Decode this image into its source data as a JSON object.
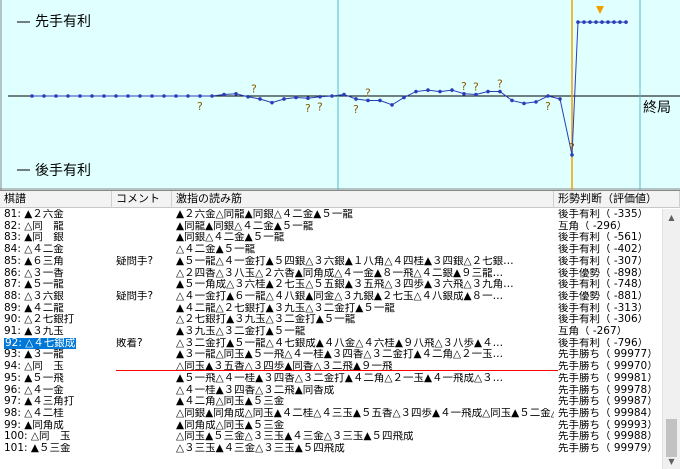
{
  "graph": {
    "label_top": "先手有利",
    "label_bottom": "後手有利",
    "label_end": "終局",
    "question_mark": "?"
  },
  "chart_data": {
    "type": "line",
    "y_axis": "評価値",
    "ylim": [
      -1000,
      1000
    ],
    "current_move": 92,
    "marker_color": "#2a3eb8",
    "background_color": "#e0ffff",
    "cursor_color": "#f0a000",
    "x": [
      2,
      4,
      6,
      8,
      10,
      12,
      14,
      16,
      18,
      20,
      22,
      24,
      26,
      28,
      30,
      32,
      34,
      36,
      38,
      40,
      42,
      44,
      46,
      48,
      50,
      52,
      54,
      56,
      58,
      60,
      62,
      64,
      66,
      68,
      70,
      72,
      74,
      76,
      78,
      80,
      82,
      84,
      86,
      88,
      90,
      92,
      93,
      94,
      95,
      96,
      97,
      98,
      99,
      100,
      101
    ],
    "values": [
      0,
      0,
      0,
      0,
      0,
      0,
      0,
      0,
      0,
      0,
      0,
      0,
      0,
      0,
      0,
      0,
      20,
      30,
      -10,
      -40,
      -90,
      -40,
      -20,
      -30,
      -10,
      0,
      20,
      -40,
      -60,
      -60,
      -120,
      -20,
      60,
      80,
      60,
      80,
      30,
      20,
      60,
      60,
      -60,
      -100,
      -80,
      0,
      -40,
      -796,
      999,
      999,
      999,
      999,
      999,
      999,
      999,
      999,
      999
    ],
    "questions_above_x": [
      39,
      58,
      74,
      76,
      80,
      92
    ],
    "questions_below_x": [
      30,
      48,
      50,
      56,
      88
    ]
  },
  "columns": {
    "move": "棋譜",
    "comment": "コメント",
    "line": "激指の読み筋",
    "eval": "形勢判断（評価値）"
  },
  "rows": [
    {
      "move": "81: ▲２六金",
      "comment": "",
      "line": "▲２六金△同龍▲同銀△４二金▲５一龍",
      "eval": "後手有利（ -335）"
    },
    {
      "move": "82: △同　龍",
      "comment": "",
      "line": "▲同龍▲同銀△４二金▲５一龍",
      "eval": "互角（ -296）"
    },
    {
      "move": "83: ▲同　銀",
      "comment": "",
      "line": "▲同銀△４二金▲５一龍",
      "eval": "後手有利（ -561）"
    },
    {
      "move": "84: △４二金",
      "comment": "",
      "line": "△４二金▲５一龍",
      "eval": "後手有利（ -402）"
    },
    {
      "move": "85: ▲６三角",
      "comment": "疑問手?",
      "line": "▲５一龍△４一金打▲５四銀△３六銀▲１八角△４四桂▲３四銀△２七銀…",
      "eval": "後手有利（ -307）"
    },
    {
      "move": "86: △３一香",
      "comment": "",
      "line": "△２四香△３八玉△２六香▲同角成△４一金▲８一飛△４二銀▲９三龍…",
      "eval": "後手優勢（ -898）"
    },
    {
      "move": "87: ▲５一龍",
      "comment": "",
      "line": "▲５一角成△３六桂▲２七玉△５五銀▲３五飛△３四歩▲３六飛△３九角…",
      "eval": "後手有利（ -748）"
    },
    {
      "move": "88: △３六銀",
      "comment": "疑問手?",
      "line": "△４一金打▲６一龍△４八銀▲同金△３九銀▲２七玉△４八銀成▲８一…",
      "eval": "後手優勢（ -881）"
    },
    {
      "move": "89: ▲４二龍",
      "comment": "",
      "line": "▲４二龍△２七銀打▲３九玉△３二金打▲５一龍",
      "eval": "後手有利（ -313）"
    },
    {
      "move": "90: △２七銀打",
      "comment": "",
      "line": "△２七銀打▲３九玉△３二金打▲５一龍",
      "eval": "後手有利（ -306）"
    },
    {
      "move": "91: ▲３九玉",
      "comment": "",
      "line": "▲３九玉△３二金打▲５一龍",
      "eval": "互角（ -267）"
    },
    {
      "move": "92: △４七銀成",
      "comment": "敗着?",
      "line": "△３二金打▲５一龍△４七銀成▲４八金△４六桂▲９八飛△３八歩▲４…",
      "eval": "後手有利（ -796）"
    },
    {
      "move": "93: ▲３一龍",
      "comment": "",
      "line": "▲３一龍△同玉▲５一飛△４一桂▲３四香△３二金打▲４二角△２一玉…",
      "eval": "先手勝ち（ 99977）"
    },
    {
      "move": "94: △同　玉",
      "comment": "",
      "line": "△同玉▲３五香△３四歩▲同香△３二飛▲９一飛",
      "eval": "先手勝ち（ 99970）"
    },
    {
      "move": "95: ▲５一飛",
      "comment": "",
      "line": "▲５一飛△４一桂▲３四香△３二金打▲４二角△２一玉▲４一飛成△３…",
      "eval": "先手勝ち（ 99981）"
    },
    {
      "move": "96: △４一金",
      "comment": "",
      "line": "△４一桂▲３四香△３二飛▲同香成",
      "eval": "先手勝ち（ 99978）"
    },
    {
      "move": "97: ▲４三角打",
      "comment": "",
      "line": "▲４二角△同玉▲５三金",
      "eval": "先手勝ち（ 99987）"
    },
    {
      "move": "98: △４二桂",
      "comment": "",
      "line": "△同銀▲同角成△同玉▲４二桂△４三玉▲５五香△３四歩▲４一飛成△同玉▲５二金△…",
      "eval": "先手勝ち（ 99984）"
    },
    {
      "move": "99: ▲同角成",
      "comment": "",
      "line": "▲同角成△同玉▲５三金",
      "eval": "先手勝ち（ 99993）"
    },
    {
      "move": "100: △同　玉",
      "comment": "",
      "line": "△同玉▲５三金△３三玉▲４三金△３三玉▲５四飛成",
      "eval": "先手勝ち（ 99988）"
    },
    {
      "move": "101: ▲５三金",
      "comment": "",
      "line": "△３三玉▲４三金△３三玉▲５四飛成",
      "eval": "先手勝ち（ 99979）"
    }
  ],
  "scrollbar": {
    "up": "▲",
    "down": "▼"
  }
}
